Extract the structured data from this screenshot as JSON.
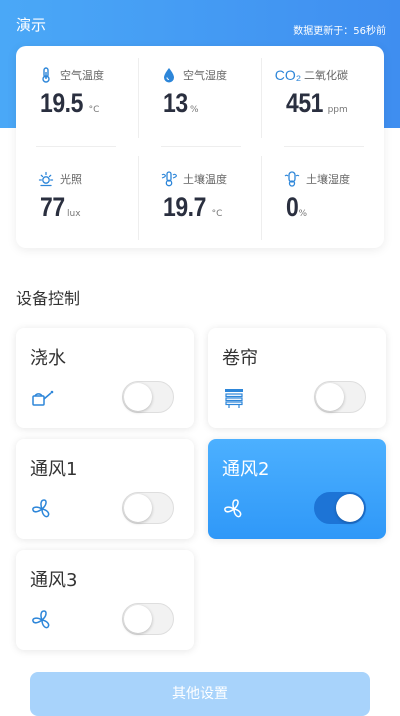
{
  "header": {
    "app_title": "演示",
    "update_text": "数据更新于：56秒前"
  },
  "sensors": [
    {
      "label": "空气温度",
      "value": "19.5",
      "unit": "°C",
      "icon": "thermometer-icon"
    },
    {
      "label": "空气湿度",
      "value": "13",
      "unit": "%",
      "icon": "water-drop-icon"
    },
    {
      "label": "二氧化碳",
      "value": "451",
      "unit": "ppm",
      "icon": "co2-icon",
      "icon_text": "CO₂"
    },
    {
      "label": "光照",
      "value": "77",
      "unit": "lux",
      "icon": "sun-icon"
    },
    {
      "label": "土壤温度",
      "value": "19.7",
      "unit": "°C",
      "icon": "soil-temperature-icon"
    },
    {
      "label": "土壤湿度",
      "value": "0",
      "unit": "%",
      "icon": "soil-moisture-icon"
    }
  ],
  "devices_section": {
    "title": "设备控制",
    "devices": [
      {
        "name": "浇水",
        "icon": "watering-can-icon",
        "on": false
      },
      {
        "name": "卷帘",
        "icon": "roller-blind-icon",
        "on": false
      },
      {
        "name": "通风1",
        "icon": "fan-icon",
        "on": false
      },
      {
        "name": "通风2",
        "icon": "fan-icon",
        "on": true
      },
      {
        "name": "通风3",
        "icon": "fan-icon",
        "on": false
      }
    ]
  },
  "bottom_button": {
    "label": "其他设置"
  },
  "colors": {
    "accent": "#3f8ef0",
    "active_card": "#3aa6ff",
    "toggle_on": "#1d74d6",
    "icon_blue": "#2d86d9"
  }
}
